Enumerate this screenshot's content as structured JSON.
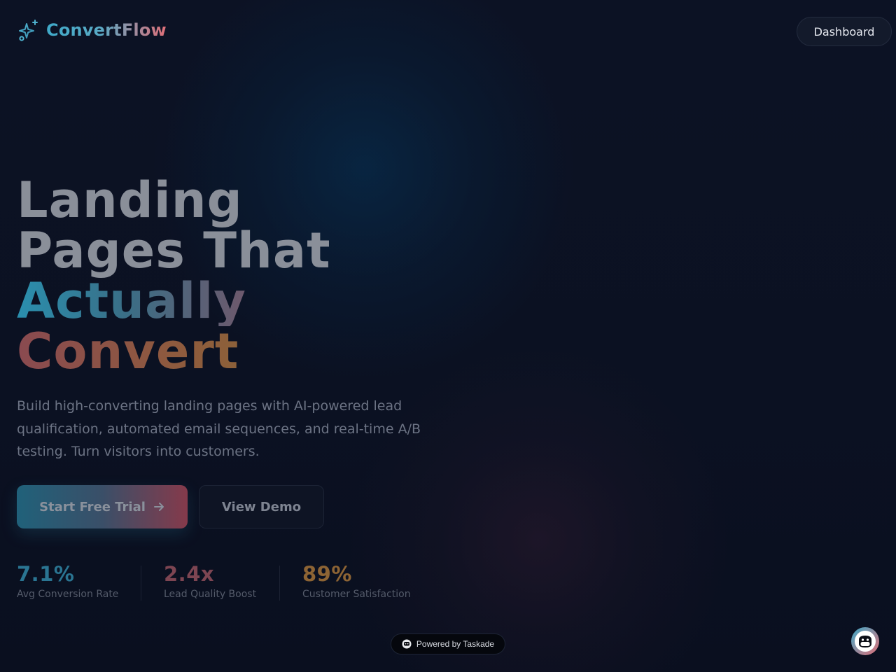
{
  "header": {
    "brand_name": "ConvertFlow",
    "logo_icon": "sparkles-icon",
    "dashboard_label": "Dashboard"
  },
  "hero": {
    "headline_line1": "Landing",
    "headline_line2": "Pages That",
    "headline_accent1": "Actually",
    "headline_accent2": "Convert",
    "subtitle": "Build high-converting landing pages with AI-powered lead qualification, automated email sequences, and real-time A/B testing. Turn visitors into customers.",
    "primary_cta": "Start Free Trial",
    "primary_cta_icon": "arrow-right-icon",
    "secondary_cta": "View Demo"
  },
  "stats": [
    {
      "value": "7.1%",
      "label": "Avg Conversion Rate",
      "color": "#2a7592"
    },
    {
      "value": "2.4x",
      "label": "Lead Quality Boost",
      "color": "#7d4552"
    },
    {
      "value": "89%",
      "label": "Customer Satisfaction",
      "color": "#8d6434"
    }
  ],
  "footer": {
    "powered_by": "Powered by Taskade",
    "powered_icon": "taskade-icon",
    "chat_icon": "bot-icon"
  },
  "colors": {
    "background": "#0b1020",
    "accent_cyan": "#3fa9c8",
    "accent_pink": "#e06f78"
  }
}
